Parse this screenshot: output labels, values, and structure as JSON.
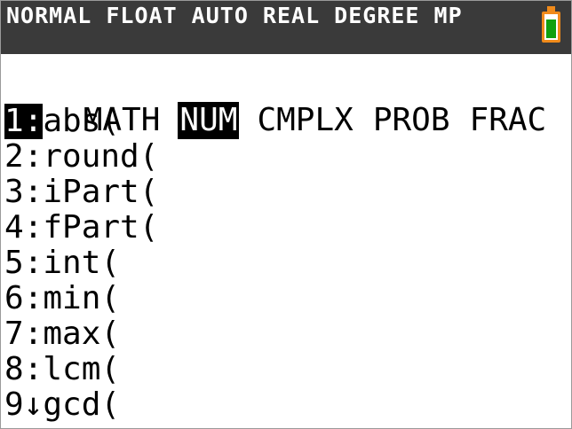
{
  "status": {
    "text": "NORMAL FLOAT AUTO REAL DEGREE MP",
    "battery_level": 0.85,
    "battery_color": "#f08a1a",
    "battery_fill_color": "#10a010",
    "background_color": "#3a3a3a"
  },
  "tabs": [
    {
      "label": "MATH",
      "selected": false
    },
    {
      "label": "NUM",
      "selected": true
    },
    {
      "label": "CMPLX",
      "selected": false
    },
    {
      "label": "PROB",
      "selected": false
    },
    {
      "label": "FRAC",
      "selected": false
    }
  ],
  "menu": [
    {
      "num": "1:",
      "label": "abs(",
      "selected": true
    },
    {
      "num": "2:",
      "label": "round(",
      "selected": false
    },
    {
      "num": "3:",
      "label": "iPart(",
      "selected": false
    },
    {
      "num": "4:",
      "label": "fPart(",
      "selected": false
    },
    {
      "num": "5:",
      "label": "int(",
      "selected": false
    },
    {
      "num": "6:",
      "label": "min(",
      "selected": false
    },
    {
      "num": "7:",
      "label": "max(",
      "selected": false
    },
    {
      "num": "8:",
      "label": "lcm(",
      "selected": false
    },
    {
      "num": "9↓",
      "label": "gcd(",
      "selected": false
    }
  ]
}
